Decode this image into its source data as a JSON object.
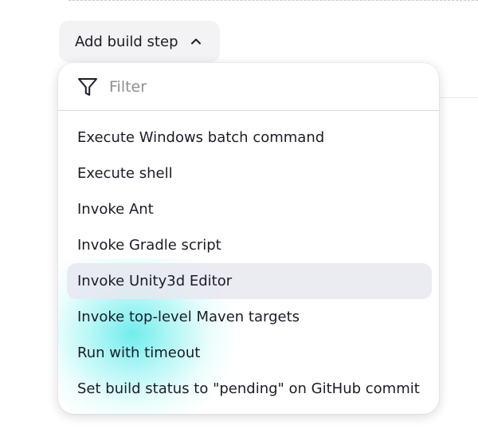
{
  "build_steps": {
    "add_button": {
      "label": "Add build step",
      "icon": "chevron-up-icon"
    },
    "dropdown": {
      "filter": {
        "icon": "filter-funnel-icon",
        "placeholder": "Filter",
        "value": ""
      },
      "items": [
        {
          "label": "Execute Windows batch command"
        },
        {
          "label": "Execute shell"
        },
        {
          "label": "Invoke Ant"
        },
        {
          "label": "Invoke Gradle script"
        },
        {
          "label": "Invoke Unity3d Editor"
        },
        {
          "label": "Invoke top-level Maven targets"
        },
        {
          "label": "Run with timeout"
        },
        {
          "label": "Set build status to \"pending\" on GitHub commit"
        }
      ],
      "highlighted_index": 4
    }
  },
  "colors": {
    "button_bg": "#f3f3f5",
    "menu_bg": "#ffffff",
    "hover_bg": "#ebebf1",
    "text": "#1c1c28",
    "placeholder": "#8e8e96",
    "cursor_glow": "#40e8e6"
  }
}
